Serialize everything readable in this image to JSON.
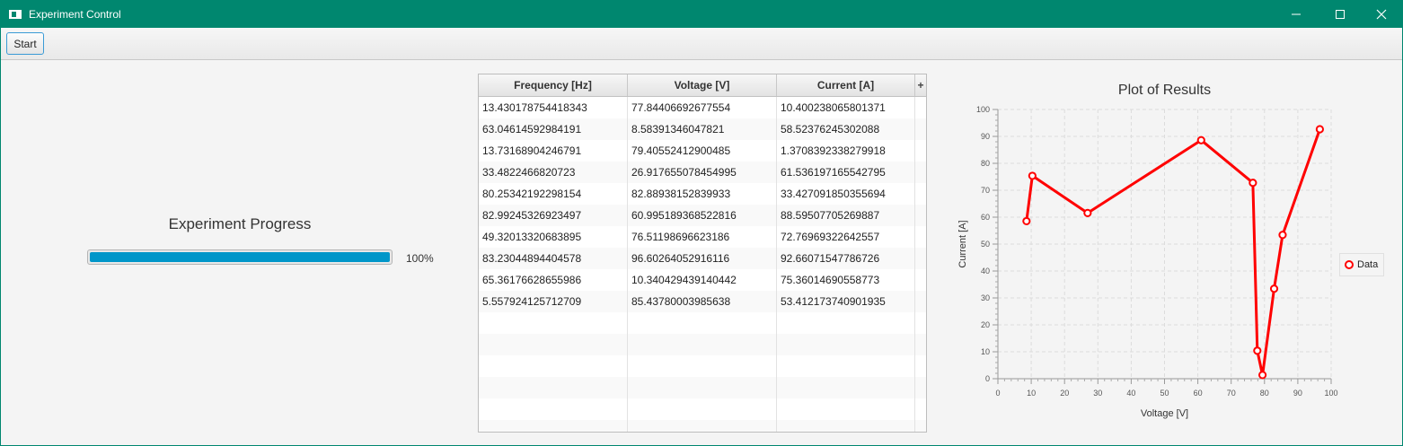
{
  "window": {
    "title": "Experiment Control"
  },
  "toolbar": {
    "start_label": "Start"
  },
  "progress": {
    "title": "Experiment Progress",
    "value": 1.0,
    "percent_label": "100%"
  },
  "table": {
    "columns": [
      "Frequency [Hz]",
      "Voltage [V]",
      "Current [A]"
    ],
    "rows": [
      [
        "13.430178754418343",
        "77.84406692677554",
        "10.400238065801371"
      ],
      [
        "63.04614592984191",
        "8.58391346047821",
        "58.52376245302088"
      ],
      [
        "13.73168904246791",
        "79.40552412900485",
        "1.3708392338279918"
      ],
      [
        "33.4822466820723",
        "26.917655078454995",
        "61.536197165542795"
      ],
      [
        "80.25342192298154",
        "82.88938152839933",
        "33.427091850355694"
      ],
      [
        "82.99245326923497",
        "60.995189368522816",
        "88.59507705269887"
      ],
      [
        "49.32013320683895",
        "76.51198696623186",
        "72.76969322642557"
      ],
      [
        "83.23044894404578",
        "96.60264052916116",
        "92.66071547786726"
      ],
      [
        "65.36176628655986",
        "10.340429439140442",
        "75.36014690558773"
      ],
      [
        "5.557924125712709",
        "85.43780003985638",
        "53.412173740901935"
      ]
    ],
    "empty_rows": 6
  },
  "chart_data": {
    "type": "line",
    "title": "Plot of Results",
    "xlabel": "Voltage [V]",
    "ylabel": "Current [A]",
    "xlim": [
      0,
      100
    ],
    "ylim": [
      0,
      100
    ],
    "xticks": [
      0,
      10,
      20,
      30,
      40,
      50,
      60,
      70,
      80,
      90,
      100
    ],
    "yticks": [
      0,
      10,
      20,
      30,
      40,
      50,
      60,
      70,
      80,
      90,
      100
    ],
    "grid": true,
    "legend_position": "right",
    "series": [
      {
        "name": "Data",
        "color": "#ff0000",
        "x": [
          8.58391346047821,
          10.340429439140442,
          26.917655078454995,
          60.995189368522816,
          76.51198696623186,
          77.84406692677554,
          79.40552412900485,
          82.88938152839933,
          85.43780003985638,
          96.60264052916116
        ],
        "y": [
          58.52376245302088,
          75.36014690558773,
          61.536197165542795,
          88.59507705269887,
          72.76969322642557,
          10.400238065801371,
          1.3708392338279918,
          33.427091850355694,
          53.412173740901935,
          92.66071547786726
        ]
      }
    ]
  }
}
